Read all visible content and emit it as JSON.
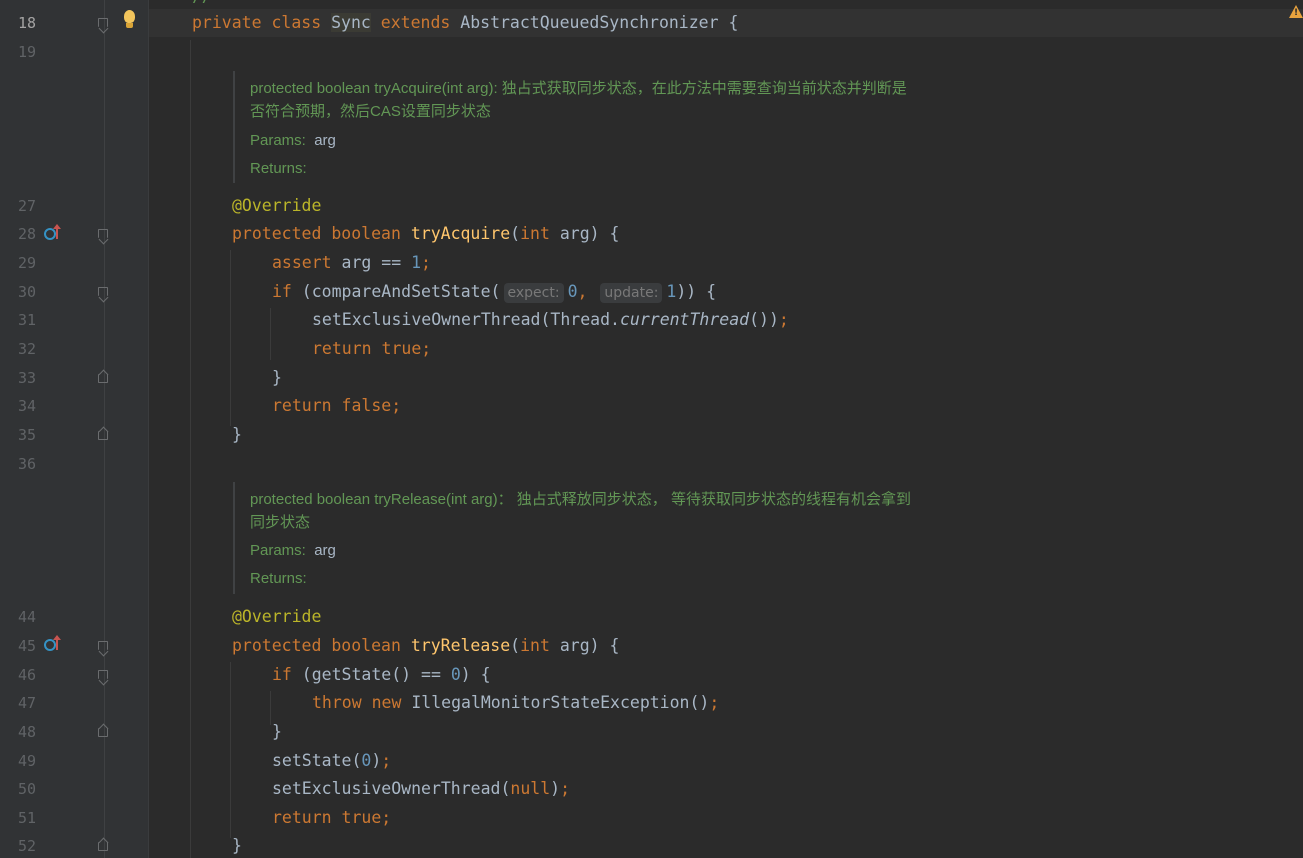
{
  "line_numbers": [
    "18",
    "19",
    "27",
    "28",
    "29",
    "30",
    "31",
    "32",
    "33",
    "34",
    "35",
    "36",
    "44",
    "45",
    "46",
    "47",
    "48",
    "49",
    "50",
    "51",
    "52"
  ],
  "editor": {
    "l18": {
      "kw1": "private",
      "kw2": "class",
      "sym": "Sync",
      "kw3": "extends",
      "rest": "AbstractQueuedSynchronizer {"
    },
    "doc1": {
      "line1": "protected boolean tryAcquire(int arg): 独占式获取同步状态，在此方法中需要查询当前状态并判断是",
      "line2": "否符合预期，然后CAS设置同步状态",
      "params_label": "Params:",
      "params_value": "arg",
      "returns_label": "Returns:"
    },
    "l27": {
      "ann": "@Override"
    },
    "l28": {
      "kw1": "protected",
      "kw2": "boolean",
      "fn": "tryAcquire",
      "p1": "(",
      "kw3": "int",
      "rest": " arg) {"
    },
    "l29": {
      "kw": "assert",
      "mid": " arg == ",
      "num": "1",
      "end": ";"
    },
    "l30": {
      "kw": "if",
      "mid": " (compareAndSetState(",
      "hint1": "expect:",
      "num1": "0",
      "comma": ",",
      "hint2": "update:",
      "num2": "1",
      "end": ")) {"
    },
    "l31": {
      "pre": "setExclusiveOwnerThread(Thread.",
      "it": "currentThread",
      "post": "())",
      "end": ";"
    },
    "l32": {
      "kw": "return true;"
    },
    "l33": {
      "text": "}"
    },
    "l34": {
      "kw": "return false;"
    },
    "l35": {
      "text": "}"
    },
    "doc2": {
      "line1": "protected boolean tryRelease(int arg)： 独占式释放同步状态， 等待获取同步状态的线程有机会拿到",
      "line2": "同步状态",
      "params_label": "Params:",
      "params_value": "arg",
      "returns_label": "Returns:"
    },
    "l44": {
      "ann": "@Override"
    },
    "l45": {
      "kw1": "protected",
      "kw2": "boolean",
      "fn": "tryRelease",
      "p1": "(",
      "kw3": "int",
      "rest": " arg) {"
    },
    "l46": {
      "kw": "if",
      "mid": " (getState() == ",
      "num": "0",
      "end": ") {"
    },
    "l47": {
      "kw": "throw new",
      "rest": " IllegalMonitorStateException()",
      "end": ";"
    },
    "l48": {
      "text": "}"
    },
    "l49": {
      "pre": "setState(",
      "num": "0",
      "post": ")",
      "end": ";"
    },
    "l50": {
      "pre": "setExclusiveOwnerThread(",
      "kw": "null",
      "post": ")",
      "end": ";"
    },
    "l51": {
      "kw": "return true;"
    },
    "l52": {
      "text": "}"
    }
  },
  "icons": {
    "intention": "lightbulb-icon",
    "override": "overrides-method-icon",
    "warning": "warning-icon"
  },
  "colors": {
    "background": "#2b2b2b",
    "gutter": "#313335",
    "keyword": "#cc7832",
    "function": "#ffc66d",
    "number": "#6897bb",
    "annotation": "#bbb529",
    "doc": "#629755",
    "text": "#a9b7c6"
  }
}
